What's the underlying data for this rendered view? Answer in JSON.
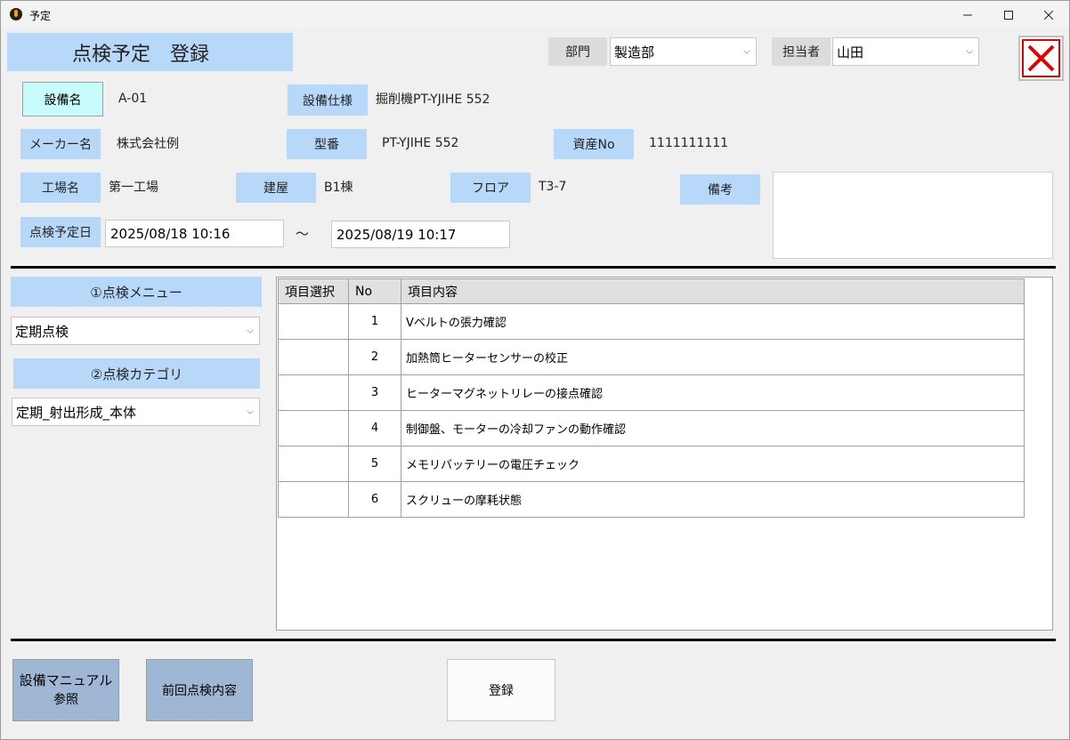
{
  "window": {
    "title": "予定"
  },
  "header": {
    "title": "点検予定　登録"
  },
  "department": {
    "label": "部門",
    "value": "製造部"
  },
  "person": {
    "label": "担当者",
    "value": "山田"
  },
  "equipment": {
    "name_label": "設備名",
    "name_value": "A-01",
    "spec_label": "設備仕様",
    "spec_value": "掘削機PT-YJIHE 552",
    "maker_label": "メーカー名",
    "maker_value": "株式会社例",
    "model_label": "型番",
    "model_value": "PT-YJIHE 552",
    "asset_label": "資産No",
    "asset_value": "1111111111",
    "factory_label": "工場名",
    "factory_value": "第一工場",
    "building_label": "建屋",
    "building_value": "B1棟",
    "floor_label": "フロア",
    "floor_value": "T3-7",
    "remarks_label": "備考"
  },
  "schedule": {
    "label": "点検予定日",
    "start": "2025/08/18 10:16",
    "separator": "～",
    "end": "2025/08/19 10:17"
  },
  "menu": {
    "label": "①点検メニュー",
    "value": "定期点検"
  },
  "category": {
    "label": "②点検カテゴリ",
    "value": "定期_射出形成_本体"
  },
  "grid": {
    "headers": [
      "項目選択",
      "No",
      "項目内容"
    ],
    "rows": [
      {
        "no": "1",
        "content": "Vベルトの張力確認"
      },
      {
        "no": "2",
        "content": "加熱筒ヒーターセンサーの校正"
      },
      {
        "no": "3",
        "content": "ヒーターマグネットリレーの接点確認"
      },
      {
        "no": "4",
        "content": "制御盤、モーターの冷却ファンの動作確認"
      },
      {
        "no": "5",
        "content": "メモリバッテリーの電圧チェック"
      },
      {
        "no": "6",
        "content": "スクリューの摩耗状態"
      }
    ]
  },
  "buttons": {
    "manual_line1": "設備マニュアル",
    "manual_line2": "参照",
    "previous": "前回点検内容",
    "register": "登録"
  },
  "colors": {
    "label_bg": "#b8d8fa",
    "name_button_bg": "#c8fbfb",
    "close_red": "#e00000",
    "footer_button_bg": "#9fb7d4"
  }
}
